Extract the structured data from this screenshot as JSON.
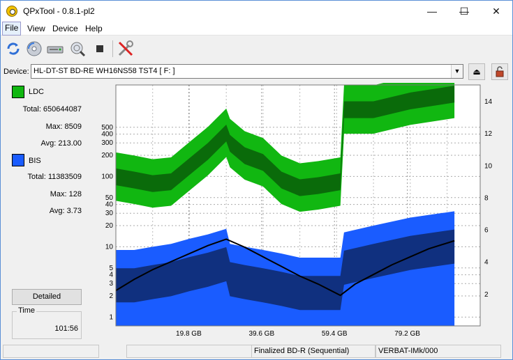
{
  "window": {
    "title": "QPxTool - 0.8.1-pl2",
    "minimize": "—",
    "maximize": "☐",
    "close": "✕"
  },
  "menu": {
    "items": [
      "File",
      "View",
      "Device",
      "Help"
    ]
  },
  "toolbar": {
    "icons": [
      "refresh-icon",
      "disc-icon",
      "drive-icon",
      "scan-icon",
      "stop-icon",
      "tools-icon"
    ]
  },
  "device": {
    "label": "Device:",
    "value": "HL-DT-ST BD-RE  WH16NS58  TST4 [ F: ]"
  },
  "legend": {
    "ldc": {
      "name": "LDC",
      "color": "#11b711"
    },
    "bis": {
      "name": "BIS",
      "color": "#1a5cff"
    }
  },
  "stats": {
    "ldc_total": "Total: 650644087",
    "ldc_max": "Max: 8509",
    "ldc_avg": "Avg: 213.00",
    "bis_total": "Total: 11383509",
    "bis_max": "Max: 128",
    "bis_avg": "Avg: 3.73"
  },
  "detailed_button": "Detailed",
  "time": {
    "label": "Time",
    "value": "101:56"
  },
  "status": {
    "cell1": "",
    "cell2": "",
    "cell3": "Finalized BD-R (Sequential)",
    "cell4": "VERBAT-IMk/000"
  },
  "chart_data": {
    "type": "area",
    "x_ticks": [
      "19.8 GB",
      "39.6 GB",
      "59.4 GB",
      "79.2 GB"
    ],
    "x_tick_values": [
      19.8,
      39.6,
      59.4,
      79.2
    ],
    "xlim": [
      0,
      99
    ],
    "y_left_ticks": [
      1,
      2,
      3,
      4,
      5,
      10,
      20,
      30,
      40,
      50,
      100,
      200,
      300,
      400,
      500
    ],
    "y_left_scale": "log",
    "ylim_left": [
      0.75,
      2000
    ],
    "y_right_ticks": [
      2,
      4,
      6,
      8,
      10,
      12,
      14
    ],
    "ylim_right": [
      0,
      15
    ],
    "grid": true,
    "series": [
      {
        "name": "LDC",
        "color": "#11b711",
        "x": [
          0,
          5,
          10,
          15,
          20,
          25,
          30,
          31,
          35,
          40,
          45,
          50,
          55,
          61,
          62,
          70,
          80,
          92
        ],
        "values": [
          100,
          90,
          80,
          85,
          140,
          230,
          420,
          300,
          200,
          160,
          90,
          70,
          75,
          85,
          900,
          900,
          1200,
          1500
        ]
      },
      {
        "name": "BIS",
        "color": "#1a5cff",
        "x": [
          0,
          5,
          10,
          15,
          20,
          25,
          30,
          31,
          35,
          40,
          45,
          50,
          55,
          61,
          62,
          70,
          80,
          92
        ],
        "values": [
          9,
          9,
          10,
          11,
          13,
          15,
          18,
          11,
          10,
          9,
          8,
          7,
          7,
          7,
          16,
          20,
          26,
          32
        ]
      },
      {
        "name": "Speed",
        "x": [
          0,
          5,
          10,
          15,
          20,
          25,
          30,
          35,
          40,
          45,
          50,
          55,
          61,
          65,
          70,
          75,
          80,
          85,
          92
        ],
        "values": [
          2.2,
          2.9,
          3.5,
          4.0,
          4.5,
          5.0,
          5.4,
          4.9,
          4.3,
          3.7,
          3.1,
          2.6,
          1.9,
          2.6,
          3.2,
          3.8,
          4.3,
          4.8,
          5.3
        ]
      }
    ]
  }
}
